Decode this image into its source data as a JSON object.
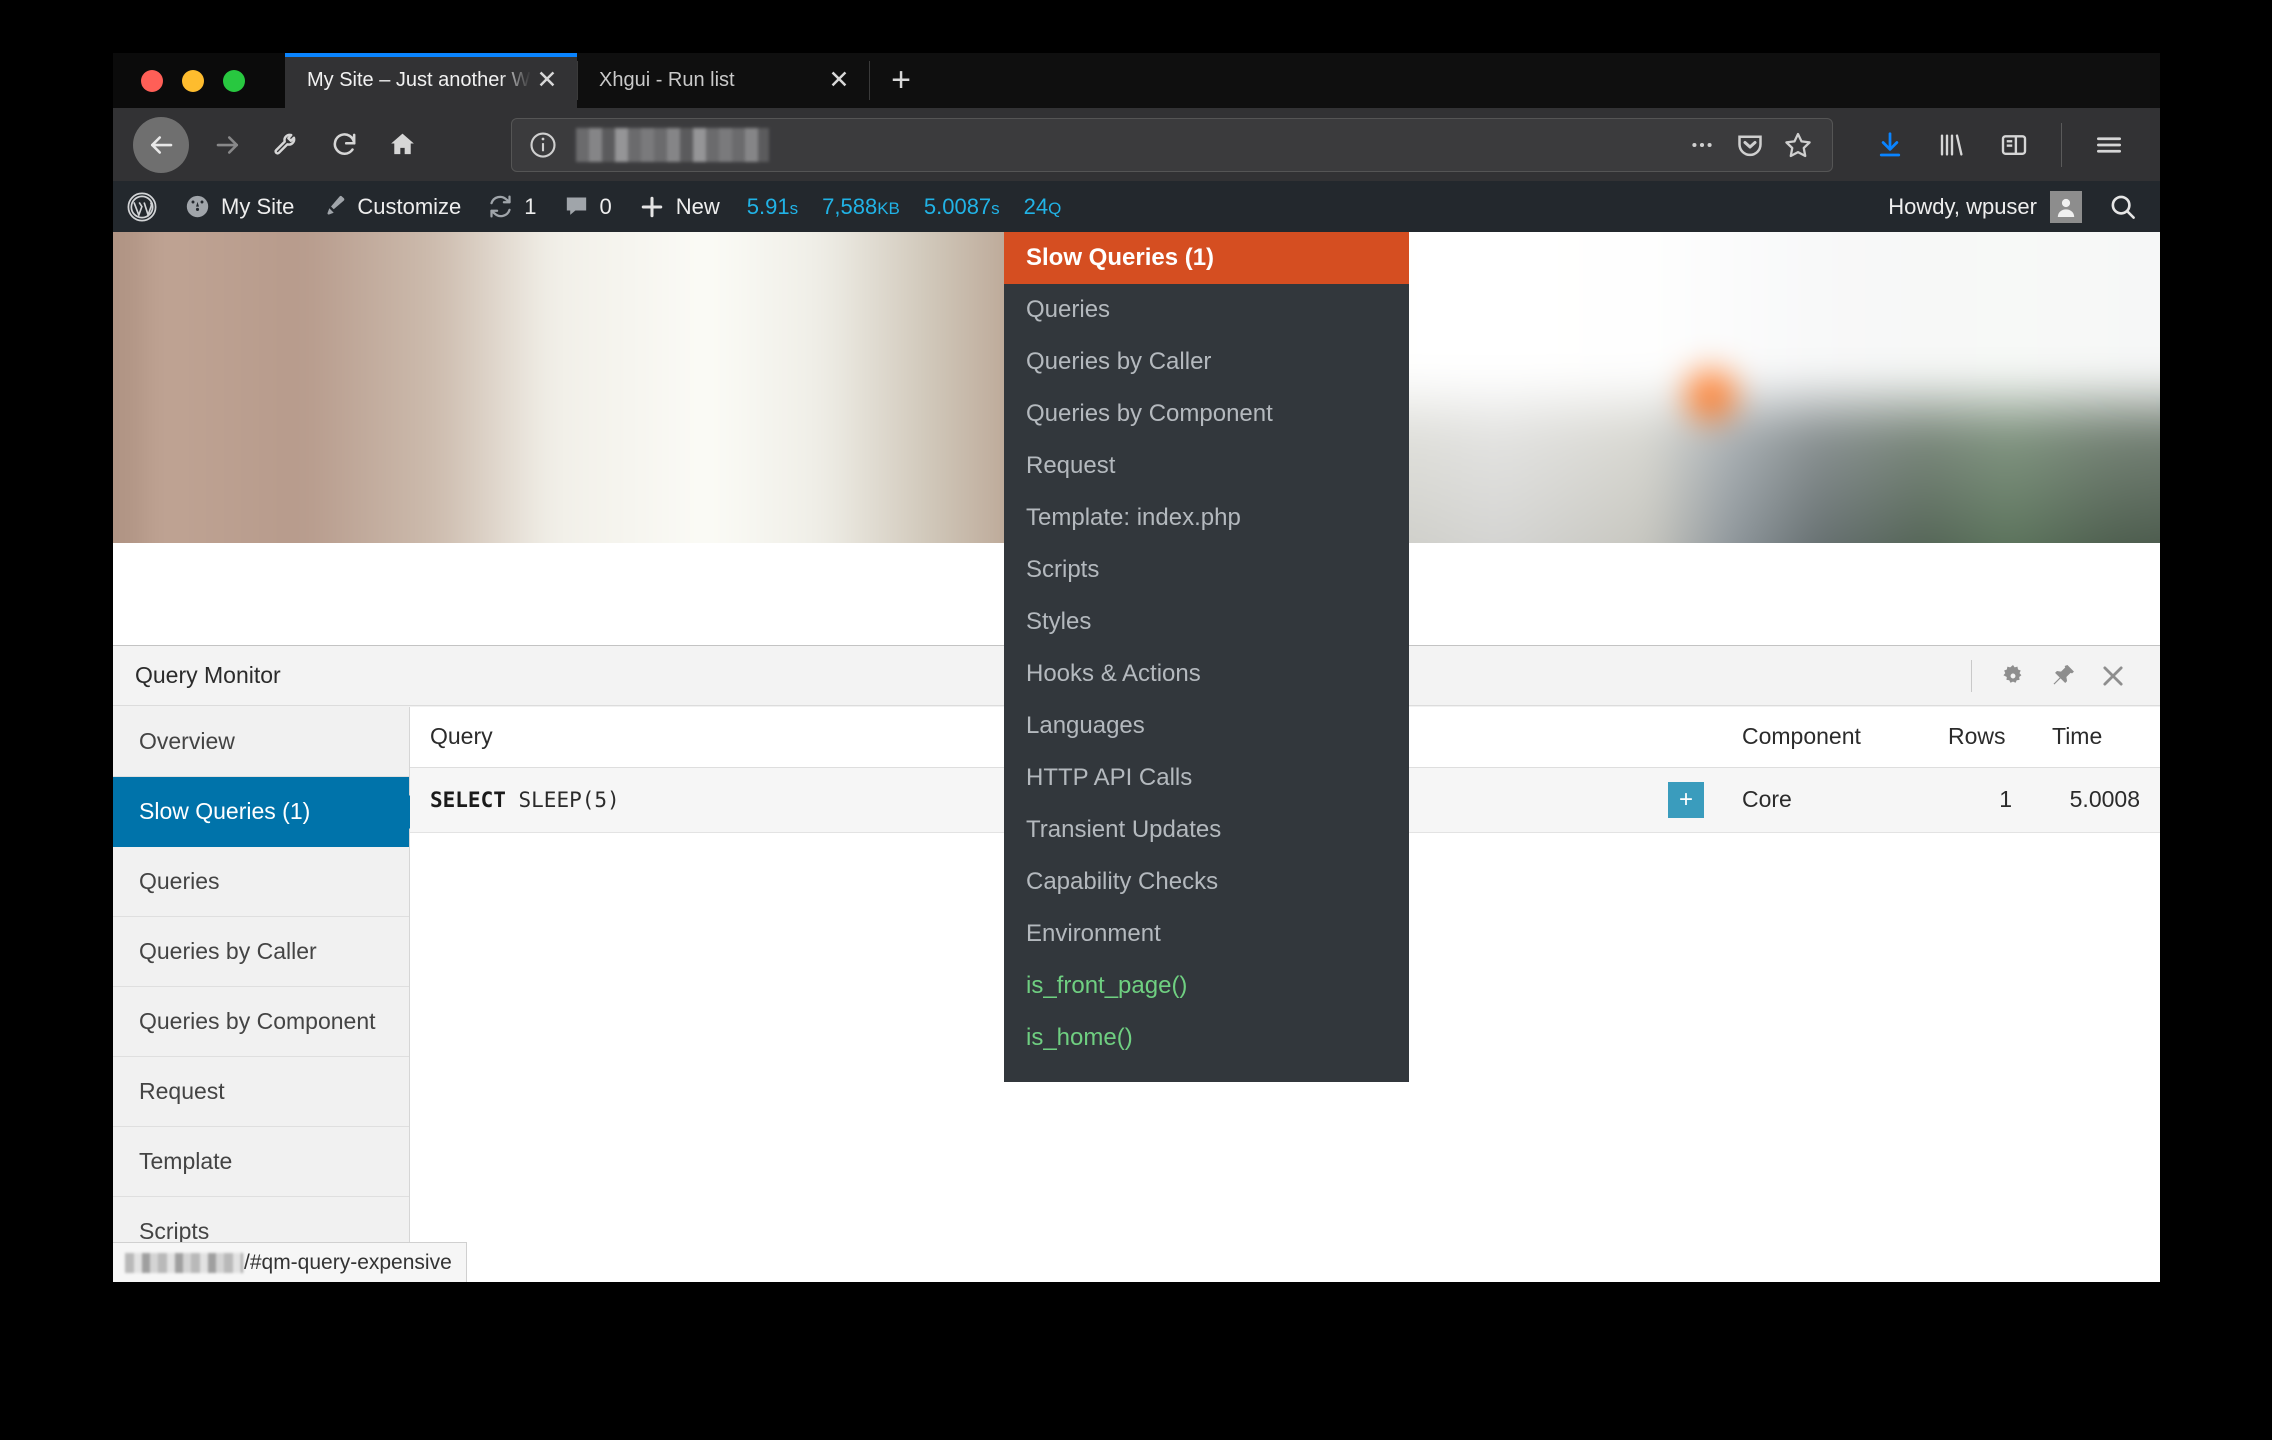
{
  "browser": {
    "tabs": [
      {
        "title": "My Site – Just another WordPress si",
        "active": true,
        "close_label": "✕"
      },
      {
        "title": "Xhgui - Run list",
        "active": false,
        "close_label": "✕"
      }
    ],
    "new_tab_label": "+",
    "toolbar": {
      "back_icon": "back-arrow-icon",
      "forward_icon": "forward-arrow-icon",
      "wrench_icon": "wrench-icon",
      "reload_icon": "reload-icon",
      "home_icon": "home-icon",
      "identity_icon": "info-circle-icon",
      "url_value": "",
      "url_redacted": true,
      "page_actions_icon": "ellipsis-icon",
      "pocket_icon": "pocket-icon",
      "bookmark_icon": "star-icon",
      "downloads_icon": "download-arrow-icon",
      "library_icon": "library-icon",
      "sidebar_icon": "sidebar-icon",
      "menu_icon": "hamburger-menu-icon"
    },
    "accent_color": "#0a84ff"
  },
  "adminbar": {
    "wp_logo_icon": "wordpress-logo-icon",
    "site_icon": "dashboard-icon",
    "site_label": "My Site",
    "customize_icon": "paintbrush-icon",
    "customize_label": "Customize",
    "updates_icon": "updates-icon",
    "updates_count": "1",
    "comments_icon": "comment-bubble-icon",
    "comments_count": "0",
    "new_icon": "plus-icon",
    "new_label": "New",
    "howdy_label": "Howdy, wpuser",
    "avatar_icon": "avatar-icon",
    "search_icon": "search-icon",
    "qm_stats": [
      {
        "value": "5.91",
        "unit": "s"
      },
      {
        "value": "7,588",
        "unit": "KB"
      },
      {
        "value": "5.0087",
        "unit": "s"
      },
      {
        "value": "24",
        "unit": "Q"
      }
    ],
    "qm_color": "#21b3e6",
    "bar_color": "#23282d"
  },
  "qm_menu": {
    "selected_color": "#d54e21",
    "conditional_color": "#6fcf81",
    "items": [
      {
        "label": "Slow Queries (1)",
        "state": "selected"
      },
      {
        "label": "Queries",
        "state": "normal"
      },
      {
        "label": "Queries by Caller",
        "state": "normal"
      },
      {
        "label": "Queries by Component",
        "state": "normal"
      },
      {
        "label": "Request",
        "state": "normal"
      },
      {
        "label": "Template: index.php",
        "state": "normal"
      },
      {
        "label": "Scripts",
        "state": "normal"
      },
      {
        "label": "Styles",
        "state": "normal"
      },
      {
        "label": "Hooks & Actions",
        "state": "normal"
      },
      {
        "label": "Languages",
        "state": "normal"
      },
      {
        "label": "HTTP API Calls",
        "state": "normal"
      },
      {
        "label": "Transient Updates",
        "state": "normal"
      },
      {
        "label": "Capability Checks",
        "state": "normal"
      },
      {
        "label": "Environment",
        "state": "normal"
      },
      {
        "label": "is_front_page()",
        "state": "conditional"
      },
      {
        "label": "is_home()",
        "state": "conditional"
      }
    ]
  },
  "qm_panel": {
    "title": "Query Monitor",
    "actions": [
      {
        "name": "settings",
        "icon": "gear-icon"
      },
      {
        "name": "pin",
        "icon": "pin-icon"
      },
      {
        "name": "close",
        "icon": "close-icon"
      }
    ],
    "nav": [
      {
        "label": "Overview",
        "active": false
      },
      {
        "label": "Slow Queries (1)",
        "active": true
      },
      {
        "label": "Queries",
        "active": false
      },
      {
        "label": "Queries by Caller",
        "active": false
      },
      {
        "label": "Queries by Component",
        "active": false
      },
      {
        "label": "Request",
        "active": false
      },
      {
        "label": "Template",
        "active": false
      },
      {
        "label": "Scripts",
        "active": false
      }
    ],
    "active_color": "#0073aa",
    "table": {
      "columns": [
        "Query",
        "",
        "Component",
        "Rows",
        "Time"
      ],
      "rows": [
        {
          "query_keyword": "SELECT",
          "query_rest": "SLEEP(5)",
          "toggle": "+",
          "component": "Core",
          "rows": "1",
          "time": "5.0008"
        }
      ]
    }
  },
  "status_bar": {
    "prefix_redacted": true,
    "text": "/#qm-query-expensive"
  }
}
